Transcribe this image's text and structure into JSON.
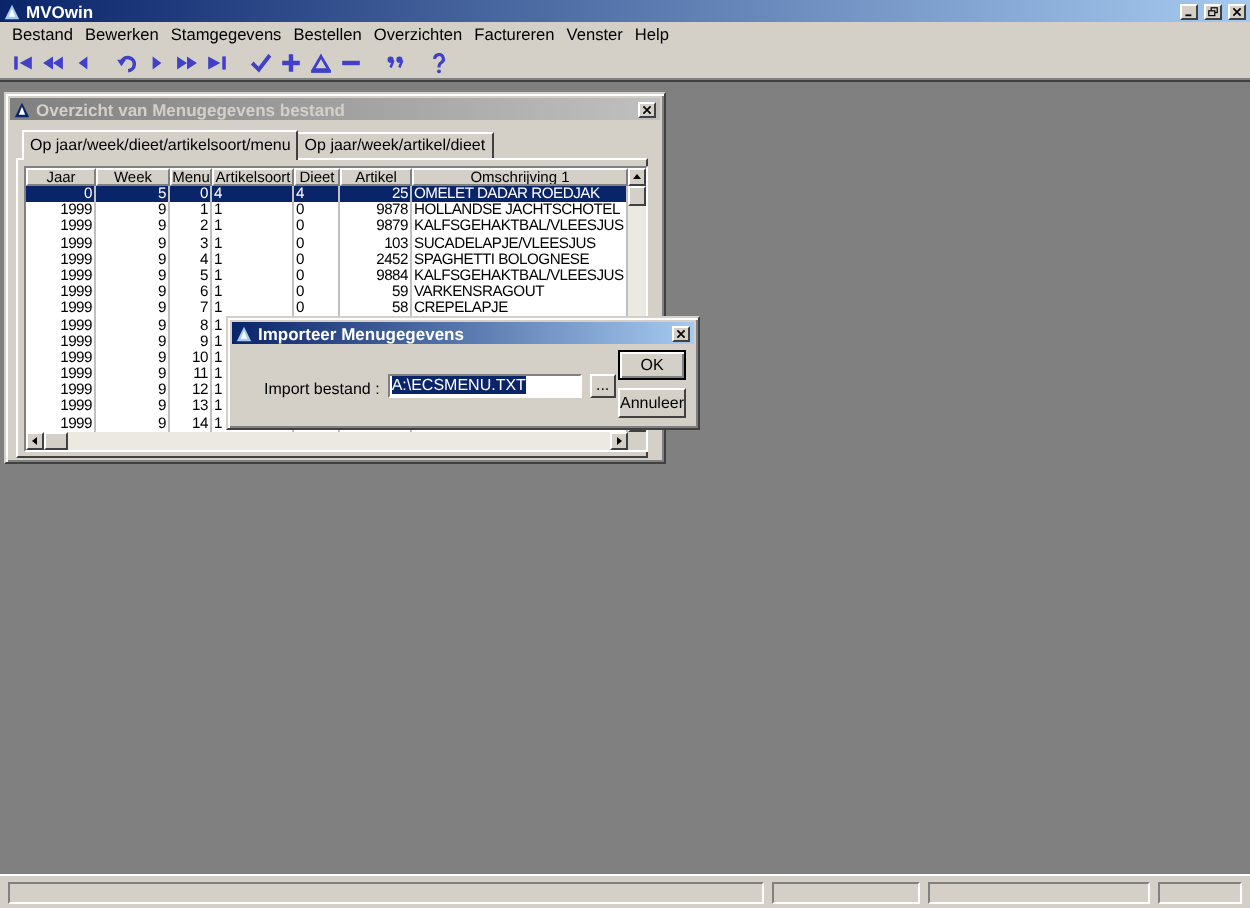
{
  "window": {
    "title": "MVOwin"
  },
  "menu": [
    {
      "label": "Bestand"
    },
    {
      "label": "Bewerken"
    },
    {
      "label": "Stamgegevens"
    },
    {
      "label": "Bestellen"
    },
    {
      "label": "Overzichten"
    },
    {
      "label": "Factureren"
    },
    {
      "label": "Venster"
    },
    {
      "label": "Help"
    }
  ],
  "child_window": {
    "title": "Overzicht van Menugegevens bestand",
    "tabs": [
      {
        "label": "Op jaar/week/dieet/artikelsoort/menu",
        "selected": true
      },
      {
        "label": "Op jaar/week/artikel/dieet",
        "selected": false
      }
    ],
    "table": {
      "columns": [
        "Jaar",
        "Week",
        "Menu",
        "Artikelsoort",
        "Dieet",
        "Artikel",
        "Omschrijving 1"
      ],
      "rows": [
        {
          "cells": [
            "0",
            "5",
            "0",
            "4",
            "4",
            "25",
            "OMELET DADAR ROEDJAK"
          ],
          "selected": true
        },
        {
          "cells": [
            "1999",
            "9",
            "1",
            "1",
            "0",
            "9878",
            "HOLLANDSE JACHTSCHOTEL"
          ],
          "selected": false
        },
        {
          "cells": [
            "1999",
            "9",
            "2",
            "1",
            "0",
            "9879",
            "KALFSGEHAKTBAL/VLEESJUS"
          ],
          "selected": false
        },
        {
          "cells": [
            "1999",
            "9",
            "3",
            "1",
            "0",
            "103",
            "SUCADELAPJE/VLEESJUS"
          ],
          "selected": false
        },
        {
          "cells": [
            "1999",
            "9",
            "4",
            "1",
            "0",
            "2452",
            "SPAGHETTI BOLOGNESE"
          ],
          "selected": false
        },
        {
          "cells": [
            "1999",
            "9",
            "5",
            "1",
            "0",
            "9884",
            "KALFSGEHAKTBAL/VLEESJUS"
          ],
          "selected": false
        },
        {
          "cells": [
            "1999",
            "9",
            "6",
            "1",
            "0",
            "59",
            "VARKENSRAGOUT"
          ],
          "selected": false
        },
        {
          "cells": [
            "1999",
            "9",
            "7",
            "1",
            "0",
            "58",
            "CREPELAPJE"
          ],
          "selected": false
        },
        {
          "cells": [
            "1999",
            "9",
            "8",
            "1"
          ],
          "selected": false
        },
        {
          "cells": [
            "1999",
            "9",
            "9",
            "1"
          ],
          "selected": false
        },
        {
          "cells": [
            "1999",
            "9",
            "10",
            "1"
          ],
          "selected": false
        },
        {
          "cells": [
            "1999",
            "9",
            "11",
            "1"
          ],
          "selected": false
        },
        {
          "cells": [
            "1999",
            "9",
            "12",
            "1"
          ],
          "selected": false
        },
        {
          "cells": [
            "1999",
            "9",
            "13",
            "1"
          ],
          "selected": false
        },
        {
          "cells": [
            "1999",
            "9",
            "14",
            "1"
          ],
          "selected": false
        }
      ]
    }
  },
  "dialog": {
    "title": "Importeer Menugegevens",
    "field_label": "Import bestand :",
    "field_value": "A:\\ECSMENU.TXT",
    "value_selected": true,
    "browse_button": "...",
    "buttons": [
      "OK",
      "Annuleer"
    ]
  }
}
